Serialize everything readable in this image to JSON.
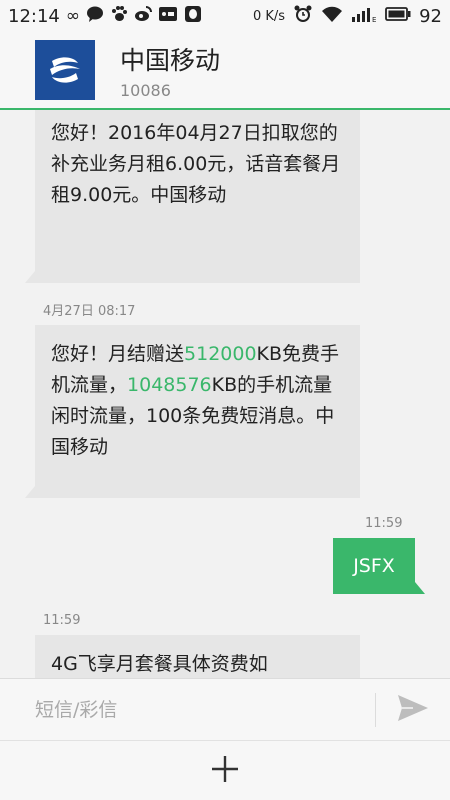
{
  "status_bar": {
    "time": "12:14",
    "network_speed": "0 K/s",
    "battery": "92",
    "icons": [
      "infinity-icon",
      "chat-bubble-icon",
      "paw-icon",
      "weibo-icon",
      "sd-card-icon",
      "qq-icon",
      "alarm-icon",
      "wifi-icon",
      "signal-icon",
      "battery-icon"
    ]
  },
  "header": {
    "contact_name": "中国移动",
    "contact_number": "10086",
    "logo_color": "#1d4e9a"
  },
  "messages": [
    {
      "direction": "incoming",
      "text": "您好！2016年04月27日扣取您的补充业务月租6.00元，话音套餐月租9.00元。中国移动"
    },
    {
      "direction": "incoming",
      "timestamp": "4月27日 08:17",
      "parts": [
        {
          "text": "您好！月结赠送",
          "link": false
        },
        {
          "text": "512000",
          "link": true
        },
        {
          "text": "KB免费手机流量，",
          "link": false
        },
        {
          "text": "1048576",
          "link": true
        },
        {
          "text": "KB的手机流量闲时流量，100条免费短消息。中国移动",
          "link": false
        }
      ]
    },
    {
      "direction": "outgoing",
      "timestamp": "11:59",
      "text": "JSFX"
    },
    {
      "direction": "incoming",
      "timestamp": "11:59",
      "text": "4G飞享月套餐具体资费如"
    }
  ],
  "compose": {
    "placeholder": "短信/彩信",
    "value": ""
  },
  "colors": {
    "accent": "#3ab76b",
    "bubble_in": "#e6e6e6"
  }
}
